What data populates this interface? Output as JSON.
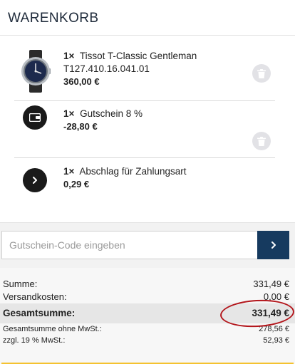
{
  "header": {
    "title": "WARENKORB"
  },
  "cart": {
    "items": [
      {
        "qty": "1×",
        "name": "Tissot T-Classic Gentleman T127.410.16.041.01",
        "price": "360,00 €",
        "icon": "watch-image"
      },
      {
        "qty": "1×",
        "name": "Gutschein 8 %",
        "price": "-28,80 €",
        "icon": "wallet-icon"
      },
      {
        "qty": "1×",
        "name": "Abschlag für Zahlungsart",
        "price": "0,29 €",
        "icon": "chevron-right-icon"
      }
    ]
  },
  "coupon": {
    "placeholder": "Gutschein-Code eingeben",
    "submit_icon": "chevron-right-icon"
  },
  "totals": {
    "sum_label": "Summe:",
    "sum_value": "331,49 €",
    "shipping_label": "Versandkosten:",
    "shipping_value": "0,00 €",
    "grand_label": "Gesamtsumme:",
    "grand_value": "331,49 €",
    "net_label": "Gesamtsumme ohne MwSt.:",
    "net_value": "278,56 €",
    "vat_label": "zzgl. 19 % MwSt.:",
    "vat_value": "52,93 €"
  },
  "colors": {
    "primary": "#163a5f",
    "highlight": "#b3151b",
    "accent_bar": "#f4c230"
  }
}
